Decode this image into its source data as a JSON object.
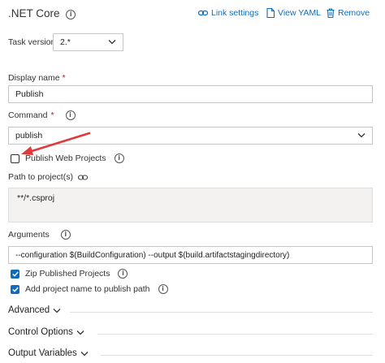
{
  "header": {
    "title": ".NET Core",
    "link_settings": "Link settings",
    "view_yaml": "View YAML",
    "remove": "Remove"
  },
  "task_version": {
    "label": "Task version",
    "value": "2.*"
  },
  "display_name": {
    "label": "Display name",
    "required_mark": "*",
    "value": "Publish"
  },
  "command": {
    "label": "Command",
    "required_mark": "*",
    "value": "publish"
  },
  "publish_web_projects": {
    "label": "Publish Web Projects",
    "checked": false
  },
  "path_to_projects": {
    "label": "Path to project(s)",
    "value": "**/*.csproj"
  },
  "arguments": {
    "label": "Arguments",
    "value": "--configuration $(BuildConfiguration) --output $(build.artifactstagingdirectory)"
  },
  "zip_published": {
    "label": "Zip Published Projects",
    "checked": true
  },
  "add_project_name": {
    "label": "Add project name to publish path",
    "checked": true
  },
  "sections": {
    "advanced": "Advanced",
    "control_options": "Control Options",
    "output_variables": "Output Variables"
  },
  "colors": {
    "accent": "#0f6cbd",
    "annotation_arrow": "#e03a3a",
    "required": "#a4262c"
  },
  "icons": [
    "info-icon",
    "link-icon",
    "yaml-icon",
    "trash-icon",
    "chevron-down-icon",
    "checkmark-icon",
    "arrow-annotation"
  ]
}
